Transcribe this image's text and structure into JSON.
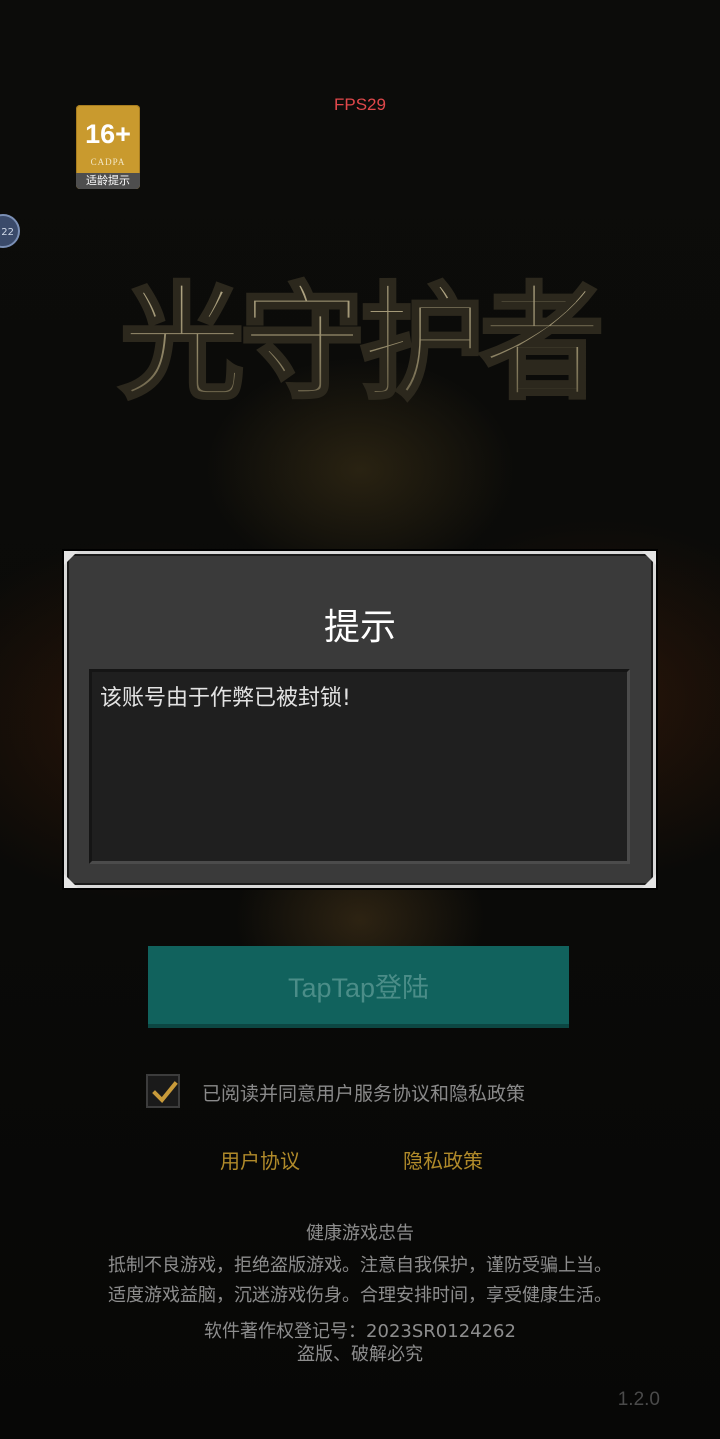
{
  "hud": {
    "fps": "FPS29"
  },
  "age_rating": {
    "rating": "16+",
    "org": "CADPA",
    "tip": "适龄提示"
  },
  "side_bubble": {
    "text": "22"
  },
  "game_title": {
    "text": "光守护者"
  },
  "dialog": {
    "title": "提示",
    "message": "该账号由于作弊已被封锁!"
  },
  "login": {
    "button_label": "TapTap登陆"
  },
  "agreement": {
    "checked": true,
    "label": "已阅读并同意用户服务协议和隐私政策",
    "terms_link": "用户协议",
    "privacy_link": "隐私政策"
  },
  "footer": {
    "heading": "健康游戏忠告",
    "line1": "抵制不良游戏，拒绝盗版游戏。注意自我保护，谨防受骗上当。",
    "line2": "适度游戏益脑，沉迷游戏伤身。合理安排时间，享受健康生活。",
    "copyright": "软件著作权登记号：2023SR0124262",
    "warning": "盗版、破解必究"
  },
  "version": "1.2.0",
  "colors": {
    "button_teal": "#11625d",
    "link_gold": "#b08a2a",
    "fps_red": "#e0484b",
    "dialog_bg": "#3a3a3a"
  }
}
